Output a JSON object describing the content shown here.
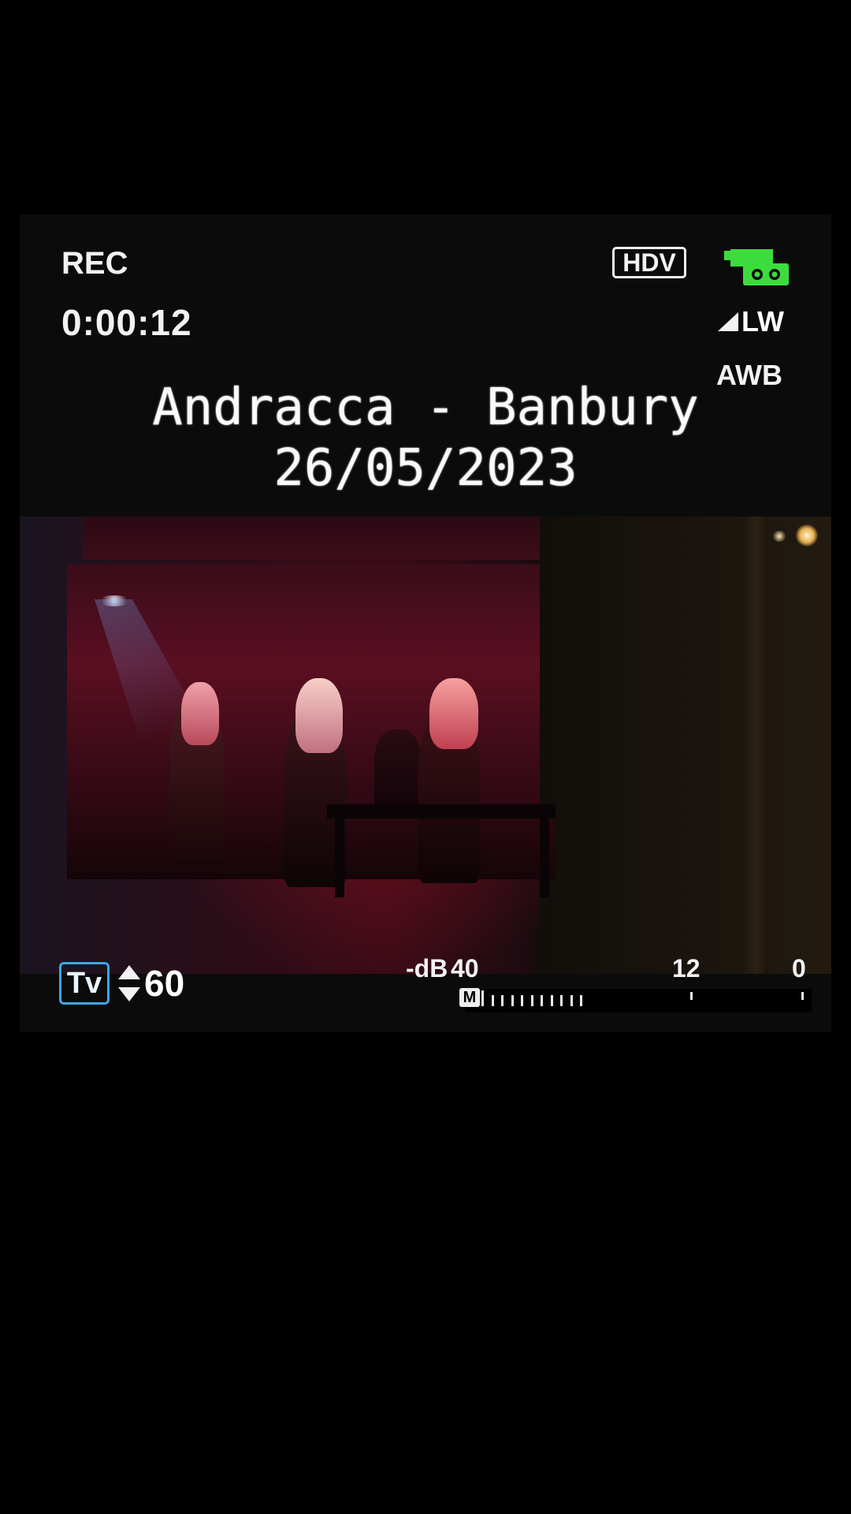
{
  "viewfinder": {
    "rec_label": "REC",
    "timecode": "0:00:12",
    "format_badge": "HDV",
    "zoom_label": "LW",
    "white_balance": "AWB",
    "colors": {
      "osd_text": "#f2f2f2",
      "tape_icon": "#3ddc3d",
      "tv_box": "#3aa8e8"
    }
  },
  "overlay": {
    "title": "Andracca - Banbury",
    "date": "26/05/2023"
  },
  "exposure": {
    "mode": "Tv",
    "shutter": "60"
  },
  "audio": {
    "unit_label": "-dB",
    "scale": [
      "40",
      "12",
      "0"
    ],
    "channel": "M",
    "level_segments_lit": 11
  }
}
